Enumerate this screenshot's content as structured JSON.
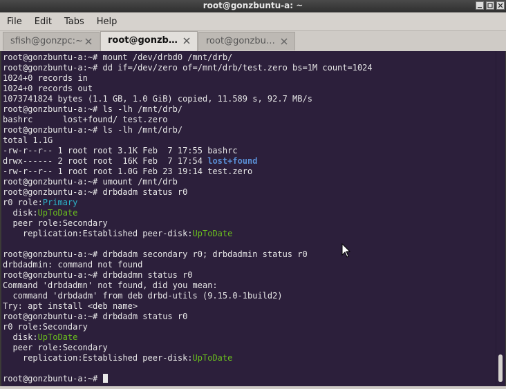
{
  "window": {
    "title": "root@gonzbuntu-a: ~",
    "controls": [
      "minimize",
      "maximize",
      "close"
    ]
  },
  "menu": [
    "File",
    "Edit",
    "Tabs",
    "Help"
  ],
  "tabs": [
    {
      "label": "sfish@gonzpc:~",
      "active": false
    },
    {
      "label": "root@gonzb…",
      "active": true
    },
    {
      "label": "root@gonzbu…",
      "active": false
    }
  ],
  "colors": {
    "terminal_bg": "#2c1f3b",
    "text": "#e8e8e8",
    "green": "#6bbf1e",
    "blue": "#5a8fd6",
    "cyan": "#2cb3c8"
  },
  "terminal": {
    "lines": [
      [
        {
          "t": "root@gonzbuntu-a:~# mount /dev/drbd0 /mnt/drb/"
        }
      ],
      [
        {
          "t": "root@gonzbuntu-a:~# dd if=/dev/zero of=/mnt/drb/test.zero bs=1M count=1024"
        }
      ],
      [
        {
          "t": "1024+0 records in"
        }
      ],
      [
        {
          "t": "1024+0 records out"
        }
      ],
      [
        {
          "t": "1073741824 bytes (1.1 GB, 1.0 GiB) copied, 11.589 s, 92.7 MB/s"
        }
      ],
      [
        {
          "t": "root@gonzbuntu-a:~# ls -lh /mnt/drb/"
        }
      ],
      [
        {
          "t": "bashrc      lost+found/ test.zero"
        }
      ],
      [
        {
          "t": "root@gonzbuntu-a:~# ls -lh /mnt/drb/"
        }
      ],
      [
        {
          "t": "total 1.1G"
        }
      ],
      [
        {
          "t": "-rw-r--r-- 1 root root 3.1K Feb  7 17:55 bashrc"
        }
      ],
      [
        {
          "t": "drwx------ 2 root root  16K Feb  7 17:54 "
        },
        {
          "t": "lost+found",
          "c": "blue"
        }
      ],
      [
        {
          "t": "-rw-r--r-- 1 root root 1.0G Feb 23 19:14 test.zero"
        }
      ],
      [
        {
          "t": "root@gonzbuntu-a:~# umount /mnt/drb"
        }
      ],
      [
        {
          "t": "root@gonzbuntu-a:~# drbdadm status r0"
        }
      ],
      [
        {
          "t": "r0 role:"
        },
        {
          "t": "Primary",
          "c": "cyan"
        }
      ],
      [
        {
          "t": "  disk:"
        },
        {
          "t": "UpToDate",
          "c": "green"
        }
      ],
      [
        {
          "t": "  peer role:Secondary"
        }
      ],
      [
        {
          "t": "    replication:Established peer-disk:"
        },
        {
          "t": "UpToDate",
          "c": "green"
        }
      ],
      [
        {
          "t": ""
        }
      ],
      [
        {
          "t": "root@gonzbuntu-a:~# drbdadm secondary r0; drbdadmin status r0"
        }
      ],
      [
        {
          "t": "drbdadmin: command not found"
        }
      ],
      [
        {
          "t": "root@gonzbuntu-a:~# drbdadmn status r0"
        }
      ],
      [
        {
          "t": "Command 'drbdadmn' not found, did you mean:"
        }
      ],
      [
        {
          "t": "  command 'drbdadm' from deb drbd-utils (9.15.0-1build2)"
        }
      ],
      [
        {
          "t": "Try: apt install <deb name>"
        }
      ],
      [
        {
          "t": "root@gonzbuntu-a:~# drbdadm status r0"
        }
      ],
      [
        {
          "t": "r0 role:Secondary"
        }
      ],
      [
        {
          "t": "  disk:"
        },
        {
          "t": "UpToDate",
          "c": "green"
        }
      ],
      [
        {
          "t": "  peer role:Secondary"
        }
      ],
      [
        {
          "t": "    replication:Established peer-disk:"
        },
        {
          "t": "UpToDate",
          "c": "green"
        }
      ],
      [
        {
          "t": ""
        }
      ],
      [
        {
          "t": "root@gonzbuntu-a:~# "
        }
      ]
    ]
  }
}
